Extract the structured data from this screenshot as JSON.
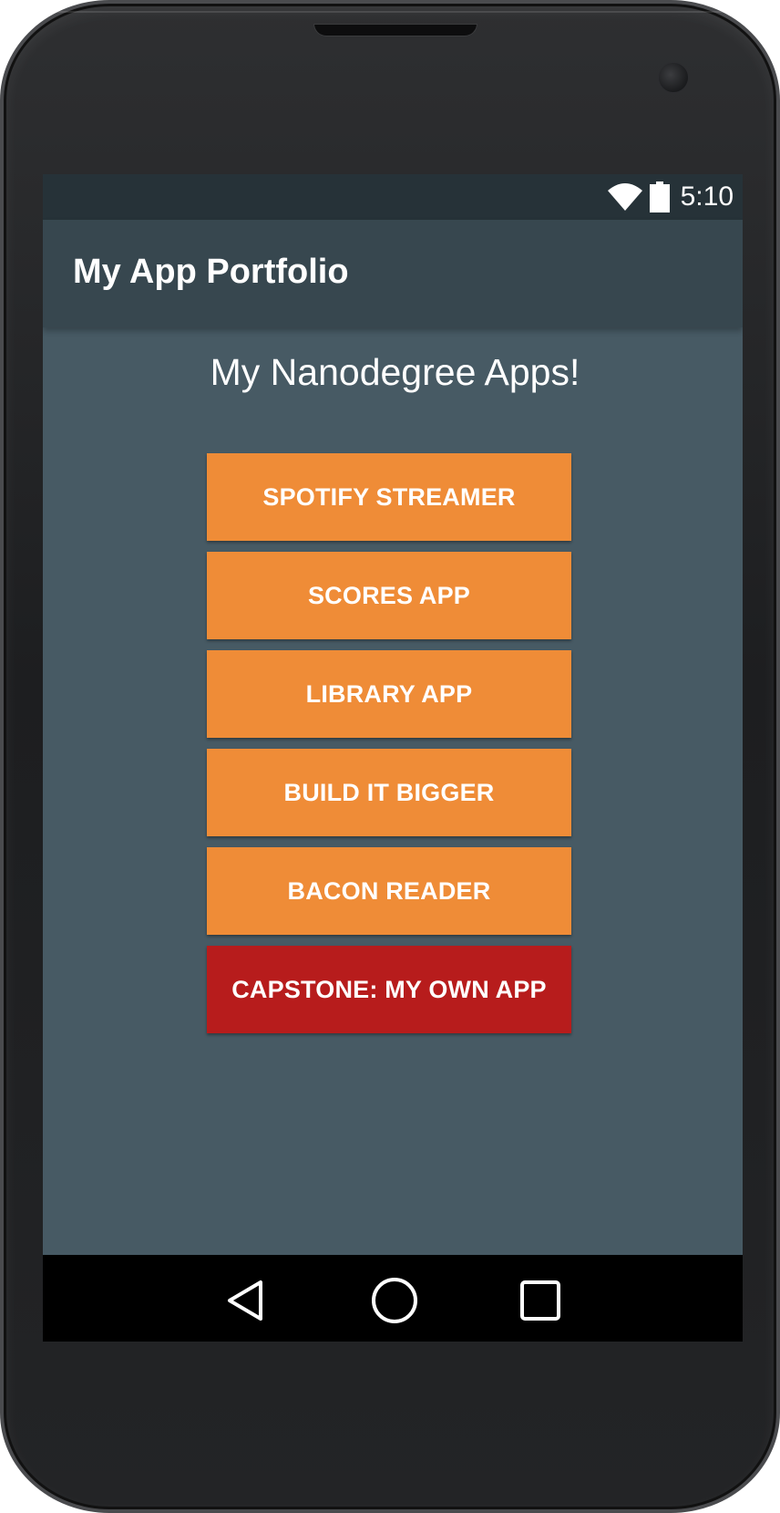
{
  "status_bar": {
    "time": "5:10",
    "wifi_icon": "wifi-icon",
    "battery_icon": "battery-icon"
  },
  "app_bar": {
    "title": "My App Portfolio"
  },
  "main": {
    "heading": "My Nanodegree Apps!",
    "buttons": [
      {
        "label": "SPOTIFY STREAMER",
        "color": "#ef8c37"
      },
      {
        "label": "SCORES APP",
        "color": "#ef8c37"
      },
      {
        "label": "LIBRARY APP",
        "color": "#ef8c37"
      },
      {
        "label": "BUILD IT BIGGER",
        "color": "#ef8c37"
      },
      {
        "label": "BACON READER",
        "color": "#ef8c37"
      },
      {
        "label": "CAPSTONE: MY OWN APP",
        "color": "#b71c1c"
      }
    ]
  },
  "nav_bar": {
    "back_icon": "back-icon",
    "home_icon": "home-icon",
    "recents_icon": "recents-icon"
  },
  "colors": {
    "background": "#475a64",
    "app_bar": "#37474f",
    "status_bar": "#263238",
    "accent": "#ef8c37",
    "capstone": "#b71c1c"
  }
}
